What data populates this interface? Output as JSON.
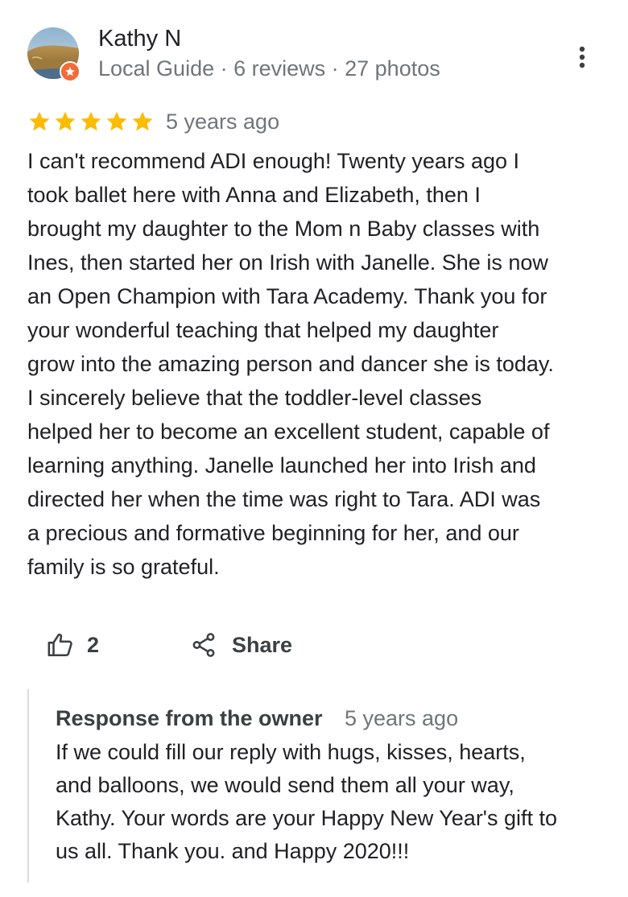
{
  "reviewer": {
    "name": "Kathy N",
    "meta": "Local Guide · 6 reviews · 27 photos",
    "avatar_icon": "landscape-avatar",
    "badge_icon": "local-guide-star-icon",
    "badge_color": "#f26b38"
  },
  "more_options_icon": "three-dots-vertical-icon",
  "rating": {
    "stars": 5,
    "max_stars": 5,
    "star_color": "#fbbc04",
    "date": "5 years ago"
  },
  "review_lines": [
    "I can't recommend ADI enough!  Twenty years ago I",
    "took ballet here with Anna and Elizabeth, then I",
    "brought my daughter to the Mom n Baby classes with",
    "Ines, then started her on Irish with Janelle. She is now",
    "an Open Champion with Tara Academy. Thank you for",
    "your wonderful teaching that helped my daughter",
    "grow into the amazing person and dancer she is today.",
    "I sincerely believe that the toddler-level classes",
    "helped her to become an excellent student, capable of",
    "learning anything. Janelle launched her into Irish and",
    "directed her when the time was right to Tara. ADI was",
    "a precious and formative beginning for her, and our",
    "family is so grateful."
  ],
  "actions": {
    "like_icon": "thumbs-up-icon",
    "like_count": "2",
    "share_icon": "share-icon",
    "share_label": "Share"
  },
  "owner_response": {
    "title": "Response from the owner",
    "date": "5 years ago",
    "lines": [
      "If we could fill our reply with hugs, kisses, hearts,",
      "and balloons, we would send them all your way,",
      "Kathy. Your words are your Happy New Year's gift to",
      "us all. Thank you. and Happy 2020!!!"
    ]
  }
}
